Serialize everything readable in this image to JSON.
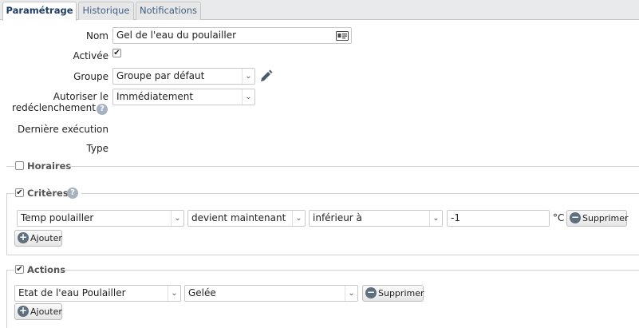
{
  "tabs": [
    {
      "label": "Paramétrage"
    },
    {
      "label": "Historique"
    },
    {
      "label": "Notifications"
    }
  ],
  "form": {
    "nom": {
      "label": "Nom",
      "value": "Gel de l'eau du poulailler",
      "icon": "id-card-icon"
    },
    "activee": {
      "label": "Activée",
      "checked": true
    },
    "groupe": {
      "label": "Groupe",
      "value": "Groupe par défaut",
      "edit_icon": "pencil-icon"
    },
    "autoriser": {
      "label_line1": "Autoriser le",
      "label_line2": "redéclenchement",
      "value": "Immédiatement"
    },
    "derniere_execution": {
      "label": "Dernière exécution",
      "value": ""
    },
    "type": {
      "label": "Type",
      "value": ""
    }
  },
  "horaires": {
    "title": "Horaires",
    "checked": false
  },
  "criteres": {
    "title": "Critères",
    "checked": true,
    "row": {
      "sensor": "Temp poulailler",
      "event": "devient maintenant",
      "operator": "inférieur à",
      "value": "-1",
      "unit": "°C",
      "delete_label": "Supprimer"
    },
    "add_label": "Ajouter"
  },
  "actions": {
    "title": "Actions",
    "checked": true,
    "row": {
      "target": "Etat de l'eau Poulailler",
      "state": "Gelée",
      "delete_label": "Supprimer"
    },
    "add_label": "Ajouter"
  },
  "colors": {
    "accent": "#1c3d66",
    "tab_text": "#3d5f86",
    "border": "#c9c9c9"
  }
}
